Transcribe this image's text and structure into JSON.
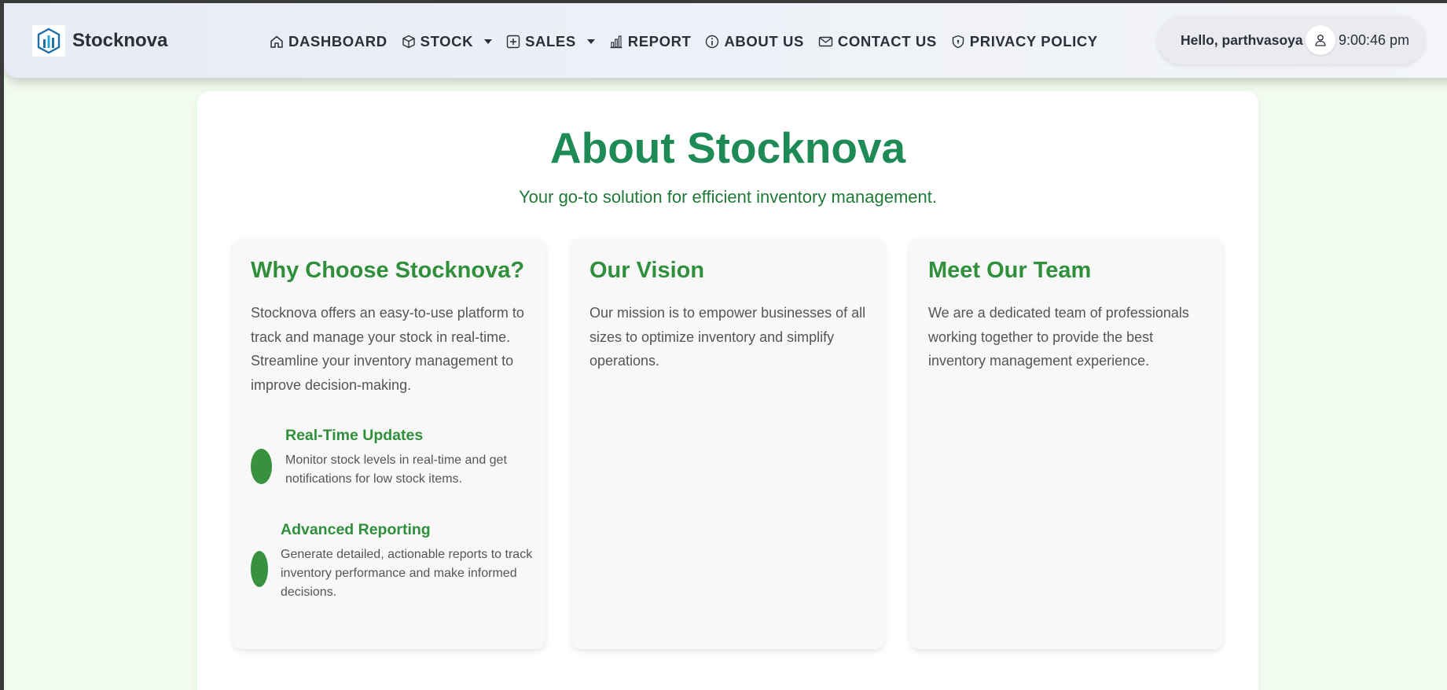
{
  "brand": {
    "name": "Stocknova",
    "logo_icon": "stocknova-logo-icon"
  },
  "nav": {
    "items": [
      {
        "label": "DASHBOARD",
        "icon": "home-icon",
        "dropdown": false
      },
      {
        "label": "STOCK",
        "icon": "box-icon",
        "dropdown": true
      },
      {
        "label": "SALES",
        "icon": "plus-square-icon",
        "dropdown": true
      },
      {
        "label": "REPORT",
        "icon": "bar-chart-icon",
        "dropdown": false
      },
      {
        "label": "ABOUT US",
        "icon": "info-icon",
        "dropdown": false
      },
      {
        "label": "CONTACT US",
        "icon": "mail-icon",
        "dropdown": false
      },
      {
        "label": "PRIVACY POLICY",
        "icon": "shield-icon",
        "dropdown": false
      }
    ]
  },
  "user": {
    "greeting": "Hello, parthvasoya",
    "avatar_icon": "user-icon",
    "time": "9:00:46 pm"
  },
  "page": {
    "title": "About Stocknova",
    "subtitle": "Your go-to solution for efficient inventory management."
  },
  "cards": [
    {
      "title": "Why Choose Stocknova?",
      "text": "Stocknova offers an easy-to-use platform to track and manage your stock in real-time. Streamline your inventory management to improve decision-making.",
      "features": [
        {
          "title": "Real-Time Updates",
          "text": "Monitor stock levels in real-time and get notifications for low stock items."
        },
        {
          "title": "Advanced Reporting",
          "text": "Generate detailed, actionable reports to track inventory performance and make informed decisions."
        }
      ]
    },
    {
      "title": "Our Vision",
      "text": "Our mission is to empower businesses of all sizes to optimize inventory and simplify operations."
    },
    {
      "title": "Meet Our Team",
      "text": "We are a dedicated team of professionals working together to provide the best inventory management experience."
    }
  ],
  "colors": {
    "primary_green": "#1e8a55",
    "card_title_green": "#2f8f3b",
    "page_background": "#f2fbf0",
    "navbar_background": "#e9ecf4"
  }
}
